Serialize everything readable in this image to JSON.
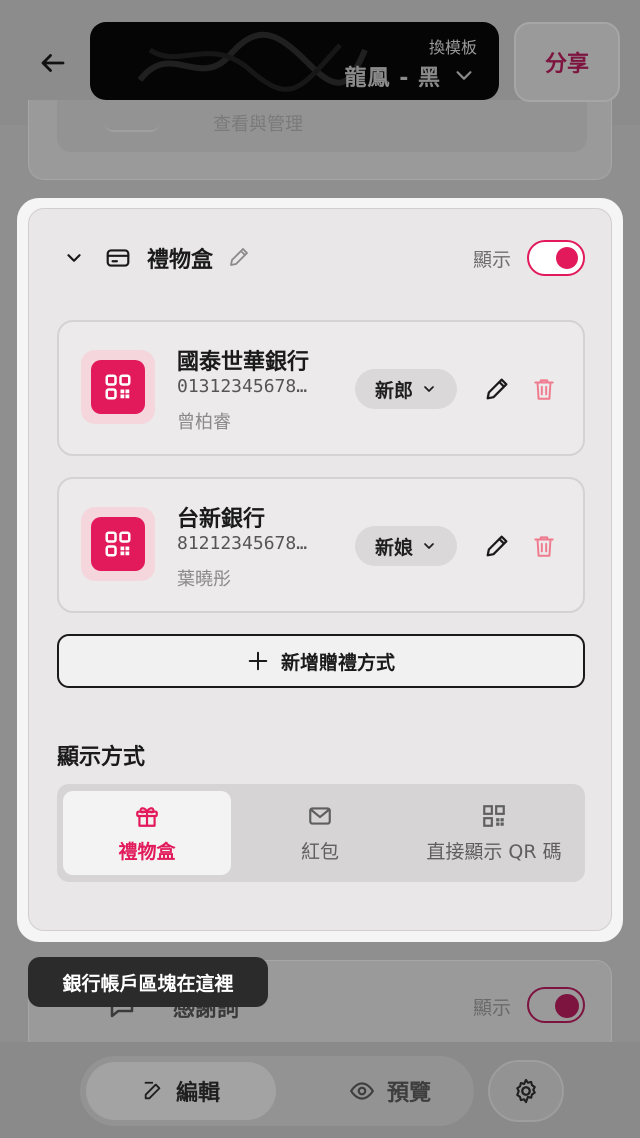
{
  "colors": {
    "accent": "#e2195b",
    "accent_tint": "#f5d6dc",
    "overlay": "#8f8f8f",
    "tooltip_bg": "#2b2b2b"
  },
  "header": {
    "back_icon": "arrow-left-icon",
    "template": {
      "hint": "換模板",
      "name": "龍鳳 - 黑",
      "icon": "chevron-down-icon"
    },
    "share_label": "分享"
  },
  "background": {
    "top_card_text": "查看與管理",
    "bottom_card": {
      "title": "感謝詞",
      "show_label": "顯示",
      "visible": true
    }
  },
  "gift_section": {
    "title": "禮物盒",
    "icon": "card-icon",
    "show_label": "顯示",
    "visible": true,
    "accounts": [
      {
        "bank": "國泰世華銀行",
        "account": "01312345678…",
        "holder": "曾柏睿",
        "role": "新郎"
      },
      {
        "bank": "台新銀行",
        "account": "81212345678…",
        "holder": "葉曉彤",
        "role": "新娘"
      }
    ],
    "add_label": "新增贈禮方式",
    "display_mode": {
      "heading": "顯示方式",
      "options": [
        {
          "label": "禮物盒",
          "icon": "gift-icon",
          "selected": true
        },
        {
          "label": "紅包",
          "icon": "envelope-icon",
          "selected": false
        },
        {
          "label": "直接顯示 QR 碼",
          "icon": "qr-code-icon",
          "selected": false
        }
      ]
    }
  },
  "tooltip": "銀行帳戶區塊在這裡",
  "bottom_nav": {
    "edit_label": "編輯",
    "preview_label": "預覽",
    "settings_icon": "gear-icon"
  }
}
